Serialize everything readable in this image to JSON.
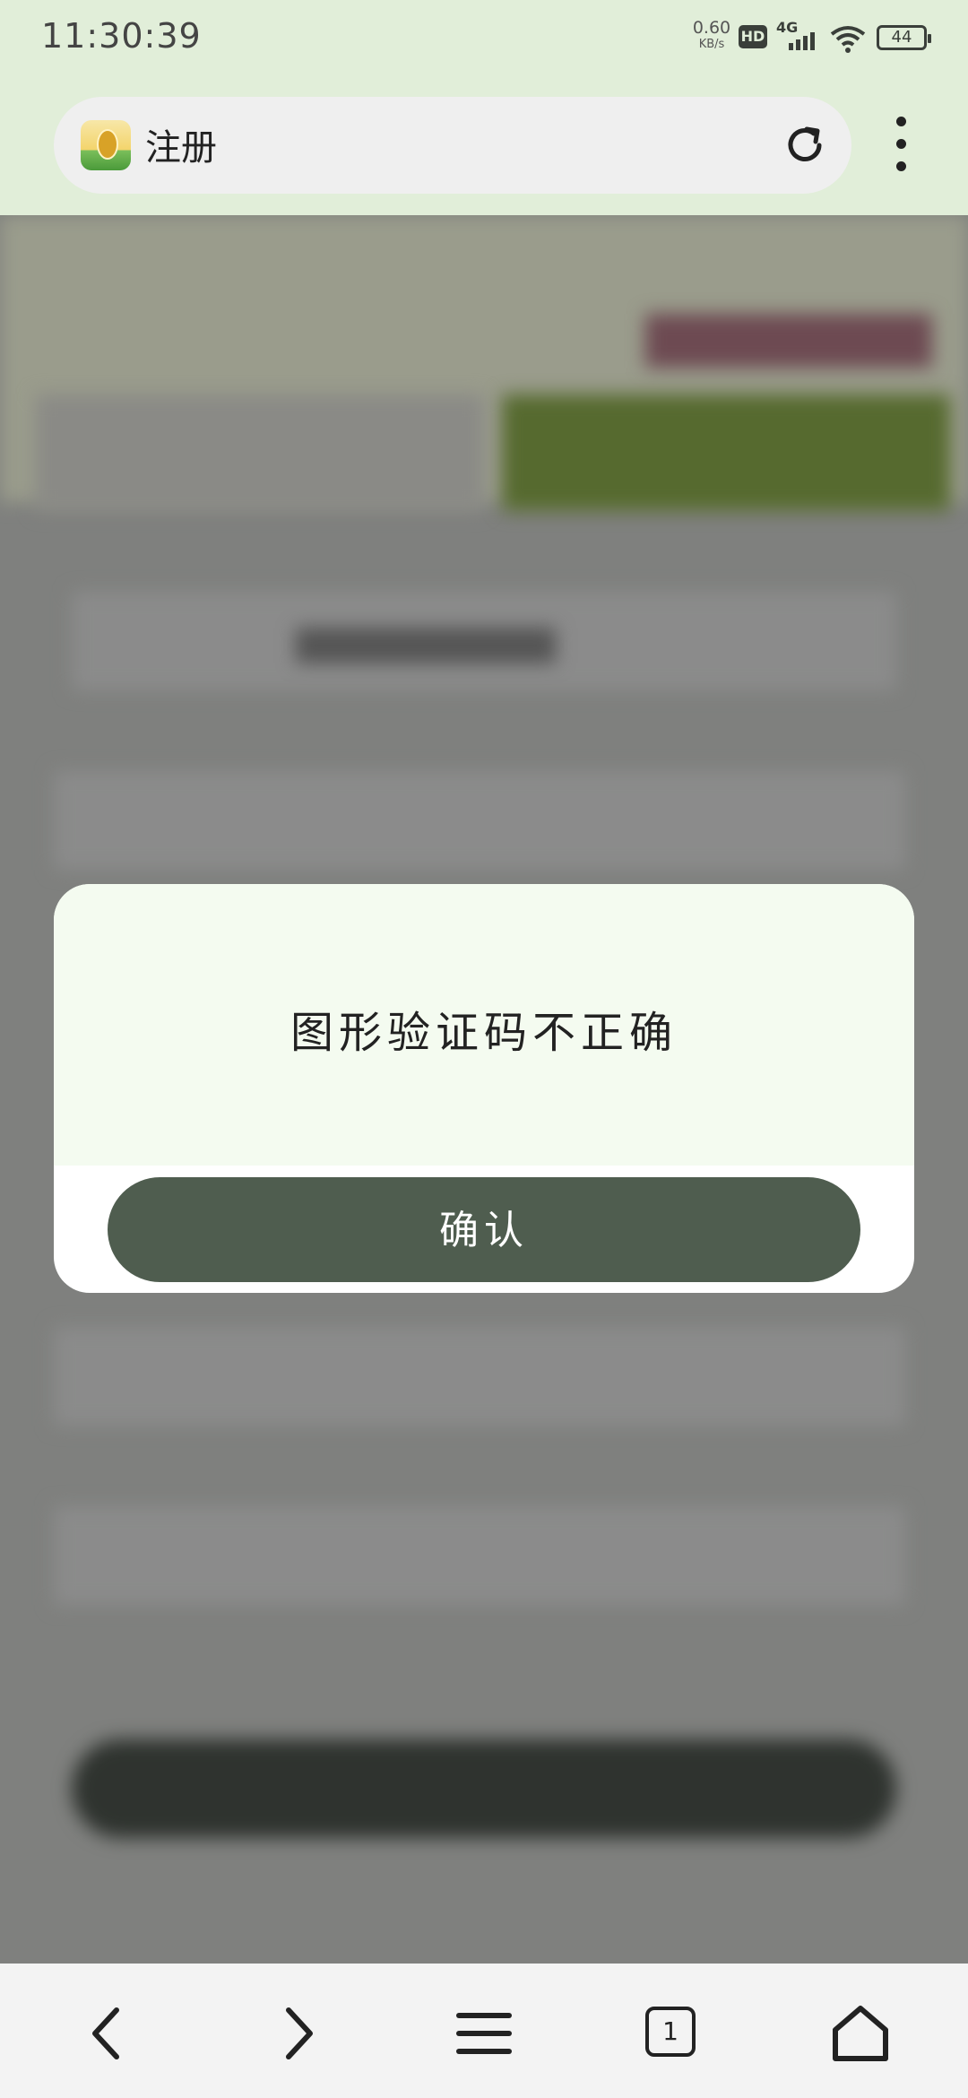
{
  "status_bar": {
    "time": "11:30:39",
    "net_speed_value": "0.60",
    "net_speed_unit": "KB/s",
    "hd": "HD",
    "network": "4G",
    "battery": "44"
  },
  "browser": {
    "page_title": "注册",
    "icons": {
      "favicon": "app-logo-icon",
      "reload": "reload-icon",
      "menu": "more-vertical-icon"
    }
  },
  "dialog": {
    "message": "图形验证码不正确",
    "confirm_label": "确认"
  },
  "bottom_nav": {
    "tab_count": "1",
    "icons": [
      "back-icon",
      "forward-icon",
      "menu-icon",
      "tabs-icon",
      "home-icon"
    ]
  },
  "colors": {
    "status_bg": "#e1eed9",
    "dialog_bg": "#f4fbf0",
    "confirm_bg": "#4f5d4f",
    "dim_overlay": "#7f807e"
  }
}
